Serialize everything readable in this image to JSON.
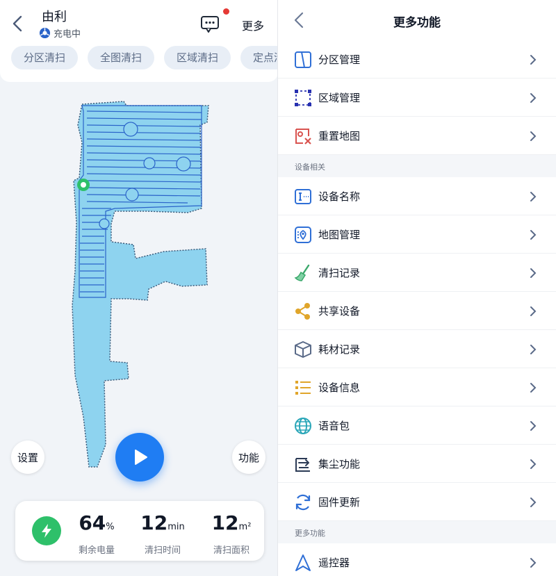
{
  "left": {
    "device_name": "由利",
    "status": "充电中",
    "more": "更多",
    "chips": [
      "分区清扫",
      "全图清扫",
      "区域清扫",
      "定点清扫"
    ],
    "settings_label": "设置",
    "function_label": "功能",
    "stats": {
      "battery": {
        "value": "64",
        "unit": "%",
        "label": "剩余电量"
      },
      "time": {
        "value": "12",
        "unit": "min",
        "label": "清扫时间"
      },
      "area": {
        "value": "12",
        "unit": "m²",
        "label": "清扫面积"
      }
    }
  },
  "right": {
    "title": "更多功能",
    "rows_top": [
      {
        "label": "分区管理",
        "icon": "split-rooms-icon"
      },
      {
        "label": "区域管理",
        "icon": "area-select-icon"
      },
      {
        "label": "重置地图",
        "icon": "reset-map-icon"
      }
    ],
    "section_device": "设备相关",
    "rows_device": [
      {
        "label": "设备名称",
        "icon": "name-card-icon"
      },
      {
        "label": "地图管理",
        "icon": "map-manage-icon"
      },
      {
        "label": "清扫记录",
        "icon": "broom-icon"
      },
      {
        "label": "共享设备",
        "icon": "share-icon"
      },
      {
        "label": "耗材记录",
        "icon": "box-icon"
      },
      {
        "label": "设备信息",
        "icon": "list-icon"
      },
      {
        "label": "语音包",
        "icon": "globe-icon"
      },
      {
        "label": "集尘功能",
        "icon": "dust-collect-icon"
      },
      {
        "label": "固件更新",
        "icon": "update-icon"
      }
    ],
    "section_more": "更多功能",
    "rows_more": [
      {
        "label": "遥控器",
        "icon": "remote-icon"
      }
    ]
  },
  "colors": {
    "accent": "#1f7df3",
    "map_fill": "#8ed3ef",
    "map_wall": "#2b5fa8",
    "battery": "#2ec06a"
  }
}
